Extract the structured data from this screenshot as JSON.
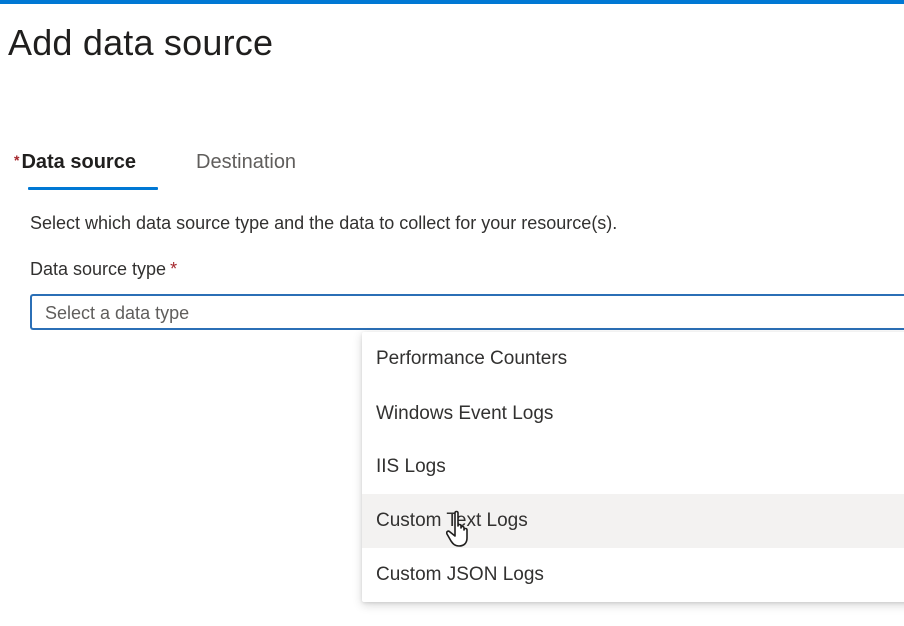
{
  "page": {
    "title": "Add data source"
  },
  "tabs": [
    {
      "label": "Data source",
      "required_mark": "*",
      "active": true
    },
    {
      "label": "Destination",
      "active": false
    }
  ],
  "form": {
    "description": "Select which data source type and the data to collect for your resource(s).",
    "field_label": "Data source type",
    "required_mark": "*",
    "select": {
      "placeholder": "Select a data type",
      "options": [
        "Performance Counters",
        "Windows Event Logs",
        "IIS Logs",
        "Custom Text Logs",
        "Custom JSON Logs"
      ],
      "hovered_option": "Custom Text Logs"
    }
  },
  "icons": {
    "cursor": "hand-pointer-icon"
  },
  "colors": {
    "accent": "#0078d4",
    "required": "#a4262c",
    "hover_background": "#f3f2f1"
  }
}
